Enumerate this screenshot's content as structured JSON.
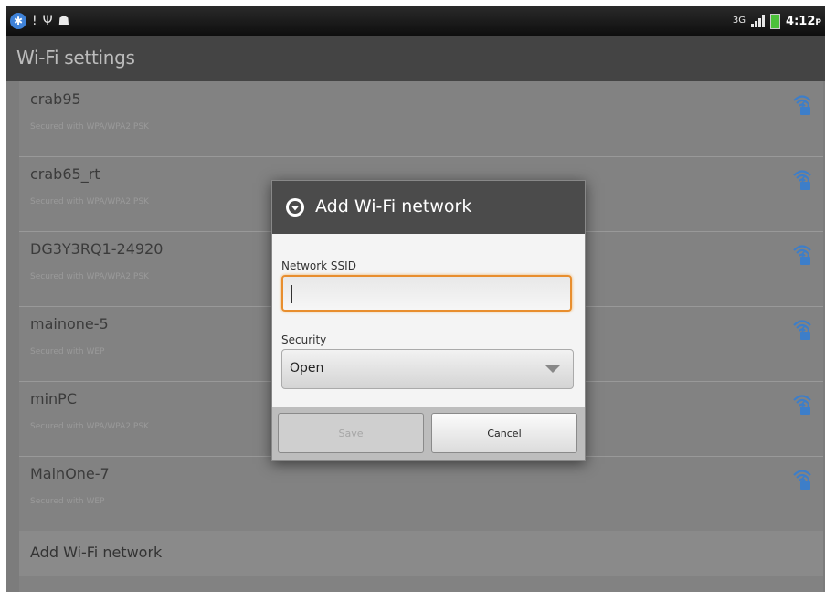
{
  "status_bar": {
    "left_icons": [
      "bluetooth-icon",
      "alert-icon",
      "usb-icon",
      "android-debug-icon"
    ],
    "right_icons": [
      "3g-icon",
      "signal-icon",
      "battery-icon"
    ],
    "network_type": "3G",
    "time": "4:12",
    "time_suffix": "P"
  },
  "header": {
    "title": "Wi-Fi settings"
  },
  "networks": [
    {
      "name": "crab95",
      "security": "Secured with WPA/WPA2 PSK"
    },
    {
      "name": "crab65_rt",
      "security": "Secured with WPA/WPA2 PSK"
    },
    {
      "name": "DG3Y3RQ1-24920",
      "security": "Secured with WPA/WPA2 PSK"
    },
    {
      "name": "mainone-5",
      "security": "Secured with WEP"
    },
    {
      "name": "minPC",
      "security": "Secured with WPA/WPA2 PSK"
    },
    {
      "name": "MainOne-7",
      "security": "Secured with WEP"
    }
  ],
  "add_network_label": "Add Wi-Fi network",
  "dialog": {
    "title": "Add Wi-Fi network",
    "ssid_label": "Network SSID",
    "ssid_value": "",
    "security_label": "Security",
    "security_value": "Open",
    "save_label": "Save",
    "cancel_label": "Cancel"
  },
  "colors": {
    "accent_focus": "#e88e2e",
    "wifi_icon": "#3d7ec9",
    "title_bar": "#444444",
    "dim_overlay": "#7c7c7c"
  }
}
